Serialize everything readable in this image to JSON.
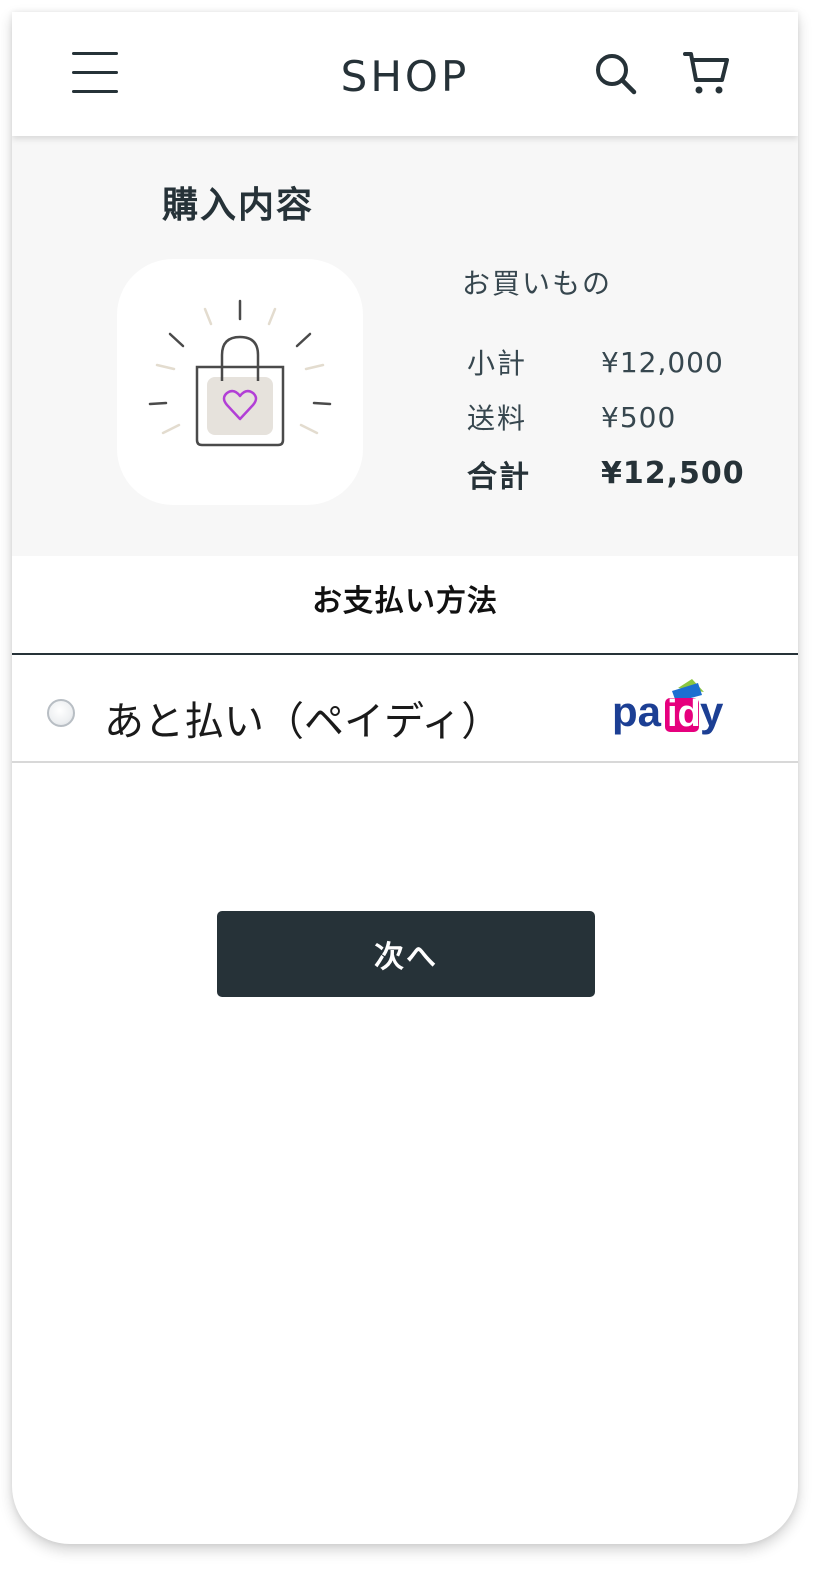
{
  "header": {
    "title": "SHOP",
    "menu_icon": "hamburger-menu-icon",
    "search_icon": "search-icon",
    "cart_icon": "cart-icon"
  },
  "summary": {
    "title": "購入内容",
    "image_icon": "shopping-bag-heart-icon",
    "order_label": "お買いもの",
    "rows": [
      {
        "label": "小計",
        "value": "¥12,000"
      },
      {
        "label": "送料",
        "value": "¥500"
      },
      {
        "label": "合計",
        "value": "¥12,500"
      }
    ]
  },
  "payment": {
    "title": "お支払い方法",
    "option": {
      "label": "あと払い（ペイディ）",
      "selected": false,
      "logo": "paidy"
    }
  },
  "next_button": {
    "label": "次へ"
  },
  "colors": {
    "primary_dark": "#263238",
    "summary_bg": "#f7f7f7",
    "paidy_blue": "#1c3f94",
    "paidy_pink": "#e6007e",
    "heart_purple": "#b23fd6"
  }
}
